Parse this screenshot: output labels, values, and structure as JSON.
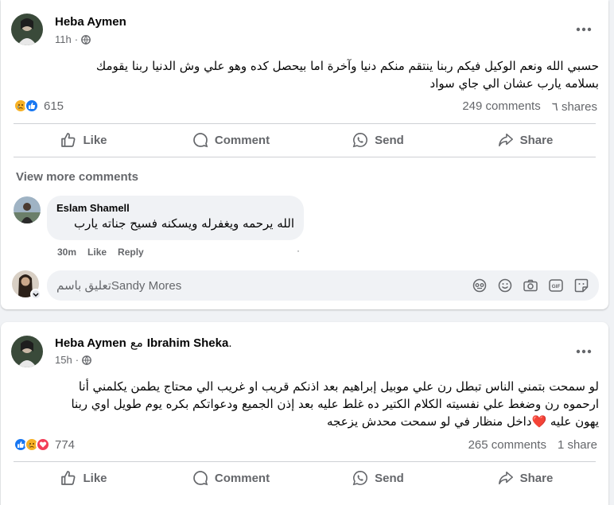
{
  "posts": [
    {
      "author": "Heba Aymen",
      "time": "11h",
      "text_line1": "حسبي الله ونعم الوكيل فيكم ربنا ينتقم منكم دنيا وآخرة اما بيحصل كده وهو علي وش الدنيا ربنا يقومك",
      "text_line2": "بسلامه يارب عشان الي جاي سواد",
      "reaction_count": "615",
      "comments": "249 comments",
      "shares": "٦ shares",
      "actions": {
        "like": "Like",
        "comment": "Comment",
        "send": "Send",
        "share": "Share"
      },
      "view_more": "View more comments",
      "comment": {
        "name": "Eslam Shamell",
        "text": "الله يرحمه ويغفرله ويسكنه فسيح جناته يارب",
        "time": "30m",
        "like": "Like",
        "reply": "Reply"
      },
      "input_placeholder": "تعليق باسمSandy Mores"
    },
    {
      "author": "Heba Aymen",
      "with_word": "مع",
      "tagged": "Ibrahim Sheka",
      "tag_suffix": ".",
      "time": "15h",
      "text_line1": "لو سمحت بتمني الناس تبطل رن علي موبيل إبراهيم بعد اذنكم قريب او غريب الي محتاج يطمن يكلمني أنا",
      "text_line2": "ارحموه رن وضغط علي نفسيته الكلام الكتير ده غلط عليه بعد إذن الجميع ودعواتكم بكره يوم طويل اوي ربنا",
      "text_line3": "يهون عليه ❤️داخل منظار في لو سمحت محدش  يزعجه",
      "reaction_count": "774",
      "comments": "265 comments",
      "shares": "1 share",
      "actions": {
        "like": "Like",
        "comment": "Comment",
        "send": "Send",
        "share": "Share"
      }
    }
  ],
  "colors": {
    "like_blue": "#1877f2",
    "love_red": "#f33e58",
    "sad_yellow": "#f7b125",
    "secondary_text": "#65676b"
  }
}
